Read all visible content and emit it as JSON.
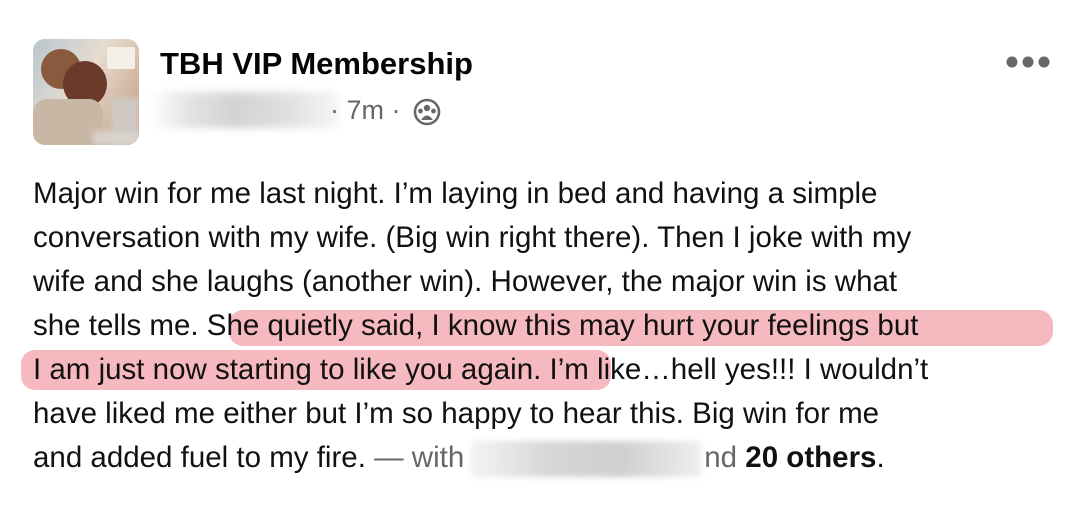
{
  "post": {
    "group_name": "TBH VIP Membership",
    "time": "· 7m ·",
    "privacy_icon": "group-members-icon",
    "more_icon": "more-dots-icon",
    "lines": [
      "Major win for me last night. I’m laying in bed and having a simple",
      "conversation with my wife. (Big win right there). Then I joke with my",
      "wife and she laughs (another win). However, the major win is what"
    ],
    "line4_plain": "she tells me. ",
    "line4_highlight": "She quietly said, I know this may hurt your feelings but",
    "line5_highlight": "I am just now starting to like you again",
    "line5_plain": ". I’m like…hell yes!!! I wouldn’t",
    "line6": "have liked me either but I’m so happy to hear this. Big win for me",
    "line7_plain": "and added fuel to my fire. ",
    "line7_with": "— with",
    "line7_and_fragment": "nd",
    "line7_others": "20 others",
    "line7_period": "."
  },
  "colors": {
    "highlight": "#ef808c",
    "meta_gray": "#65676b",
    "text": "#050505"
  }
}
